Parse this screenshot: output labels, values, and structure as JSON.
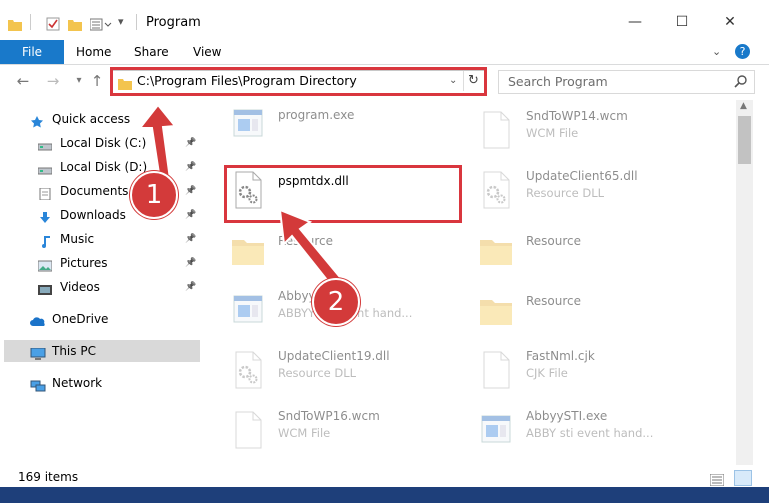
{
  "window": {
    "title": "Program",
    "controls": {
      "minimize": "—",
      "maximize": "☐",
      "close": "✕"
    }
  },
  "ribbon": {
    "tabs": [
      "File",
      "Home",
      "Share",
      "View"
    ]
  },
  "nav": {
    "address": "C:\\Program Files\\Program Directory",
    "search_placeholder": "Search Program"
  },
  "sidebar": {
    "items": [
      {
        "label": "Quick access",
        "icon": "star-icon",
        "pinned": false
      },
      {
        "label": "Local Disk (C:)",
        "icon": "drive-icon",
        "pinned": true
      },
      {
        "label": "Local Disk (D:)",
        "icon": "drive-icon",
        "pinned": true
      },
      {
        "label": "Documents",
        "icon": "documents-icon",
        "pinned": true
      },
      {
        "label": "Downloads",
        "icon": "downloads-icon",
        "pinned": true
      },
      {
        "label": "Music",
        "icon": "music-icon",
        "pinned": true
      },
      {
        "label": "Pictures",
        "icon": "pictures-icon",
        "pinned": true
      },
      {
        "label": "Videos",
        "icon": "videos-icon",
        "pinned": true
      },
      {
        "label": "OneDrive",
        "icon": "onedrive-icon",
        "pinned": false
      },
      {
        "label": "This PC",
        "icon": "this-pc-icon",
        "pinned": false,
        "selected": true
      },
      {
        "label": "Network",
        "icon": "network-icon",
        "pinned": false
      }
    ]
  },
  "files": [
    {
      "name": "program.exe",
      "type": "",
      "icon": "exe-icon"
    },
    {
      "name": "SndToWP14.wcm",
      "type": "WCM File",
      "icon": "file-icon"
    },
    {
      "name": "pspmtdx.dll",
      "type": "",
      "icon": "dll-icon"
    },
    {
      "name": "UpdateClient65.dll",
      "type": "Resource DLL",
      "icon": "dll-icon"
    },
    {
      "name": "Resource",
      "type": "",
      "icon": "folder-icon"
    },
    {
      "name": "Resource",
      "type": "",
      "icon": "folder-icon"
    },
    {
      "name": "AbbyySTI.exe",
      "type": "ABBYY sti event hand...",
      "icon": "exe-icon"
    },
    {
      "name": "Resource",
      "type": "",
      "icon": "folder-icon"
    },
    {
      "name": "UpdateClient19.dll",
      "type": "Resource DLL",
      "icon": "dll-icon"
    },
    {
      "name": "FastNml.cjk",
      "type": "CJK File",
      "icon": "file-icon"
    },
    {
      "name": "SndToWP16.wcm",
      "type": "WCM File",
      "icon": "file-icon"
    },
    {
      "name": "AbbyySTI.exe",
      "type": "ABBY sti event hand...",
      "icon": "exe-icon"
    }
  ],
  "status": {
    "item_count": "169 items"
  },
  "annotations": {
    "step1": "1",
    "step2": "2",
    "color": "#d33a3a"
  }
}
